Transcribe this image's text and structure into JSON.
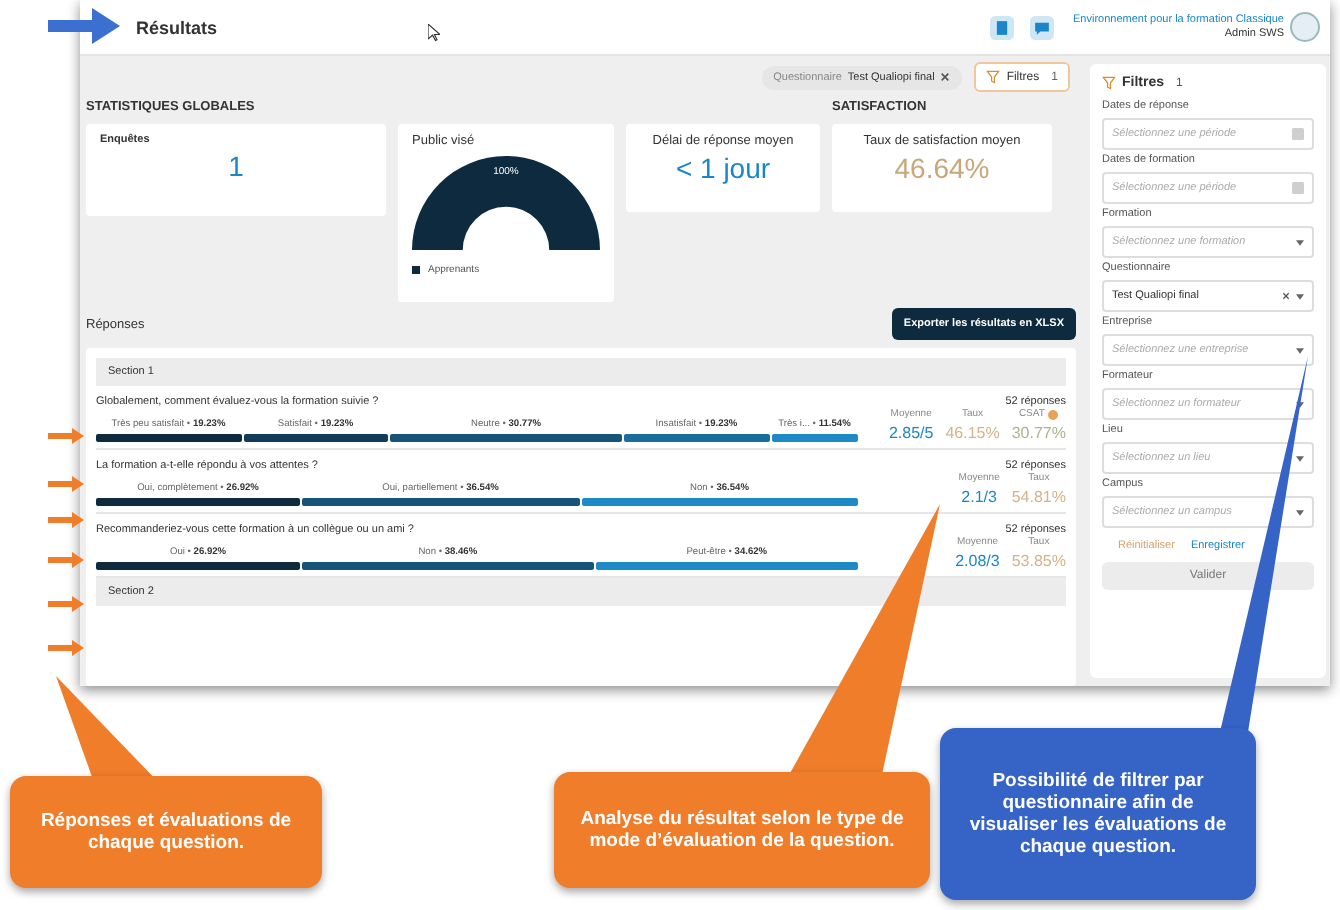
{
  "header": {
    "title": "Résultats",
    "org": "Environnement pour la formation Classique",
    "user": "Admin SWS"
  },
  "active_filter": {
    "label": "Questionnaire",
    "value": "Test Qualiopi final"
  },
  "filters_button": {
    "label": "Filtres",
    "count": "1"
  },
  "global_stats": {
    "title": "STATISTIQUES GLOBALES",
    "surveys": {
      "label": "Enquêtes",
      "value": "1"
    },
    "audience": {
      "label": "Public visé",
      "percent": "100%",
      "legend": "Apprenants"
    },
    "delay": {
      "label": "Délai de réponse moyen",
      "value": "< 1 jour"
    }
  },
  "satisfaction": {
    "title": "SATISFACTION",
    "label": "Taux de satisfaction moyen",
    "value": "46.64%"
  },
  "responses": {
    "title": "Réponses",
    "export_button": "Exporter les résultats en XLSX",
    "sections": [
      {
        "title": "Section 1",
        "questions": [
          {
            "text": "Globalement, comment évaluez-vous la formation suivie ?",
            "count": "52 réponses",
            "segments": [
              {
                "label": "Très peu satisfait •",
                "value": "19.23%",
                "color": "#0d2a3f"
              },
              {
                "label": "Satisfait •",
                "value": "19.23%",
                "color": "#123d5a"
              },
              {
                "label": "Neutre •",
                "value": "30.77%",
                "color": "#16547a"
              },
              {
                "label": "Insatisfait •",
                "value": "19.23%",
                "color": "#1b6d9c"
              },
              {
                "label": "Très i... •",
                "value": "11.54%",
                "color": "#1f8ac8"
              }
            ],
            "metrics": [
              {
                "label": "Moyenne",
                "value": "2.85/5",
                "kind": "average",
                "help": false
              },
              {
                "label": "Taux",
                "value": "46.15%",
                "kind": "rate",
                "help": false
              },
              {
                "label": "CSAT",
                "value": "30.77%",
                "kind": "csat",
                "help": true
              }
            ]
          },
          {
            "text": "La formation a-t-elle répondu à vos attentes ?",
            "count": "52 réponses",
            "segments": [
              {
                "label": "Oui, complètement •",
                "value": "26.92%",
                "color": "#0d2a3f"
              },
              {
                "label": "Oui, partiellement •",
                "value": "36.54%",
                "color": "#16547a"
              },
              {
                "label": "Non •",
                "value": "36.54%",
                "color": "#1f8ac8"
              }
            ],
            "metrics": [
              {
                "label": "Moyenne",
                "value": "2.1/3",
                "kind": "average",
                "help": false
              },
              {
                "label": "Taux",
                "value": "54.81%",
                "kind": "rate",
                "help": false
              }
            ]
          },
          {
            "text": "Recommanderiez-vous cette formation à un collègue ou un ami ?",
            "count": "52 réponses",
            "segments": [
              {
                "label": "Oui •",
                "value": "26.92%",
                "color": "#0d2a3f"
              },
              {
                "label": "Non •",
                "value": "38.46%",
                "color": "#16547a"
              },
              {
                "label": "Peut-être •",
                "value": "34.62%",
                "color": "#1f8ac8"
              }
            ],
            "metrics": [
              {
                "label": "Moyenne",
                "value": "2.08/3",
                "kind": "average",
                "help": false
              },
              {
                "label": "Taux",
                "value": "53.85%",
                "kind": "rate",
                "help": false
              }
            ]
          }
        ]
      },
      {
        "title": "Section 2"
      }
    ]
  },
  "filter_panel": {
    "title": "Filtres",
    "count": "1",
    "fields": [
      {
        "label": "Dates de réponse",
        "placeholder": "Sélectionnez une période",
        "kind": "date"
      },
      {
        "label": "Dates de formation",
        "placeholder": "Sélectionnez une période",
        "kind": "date"
      },
      {
        "label": "Formation",
        "placeholder": "Sélectionnez une formation",
        "kind": "select"
      },
      {
        "label": "Questionnaire",
        "value": "Test Qualiopi final",
        "kind": "select"
      },
      {
        "label": "Entreprise",
        "placeholder": "Sélectionnez une entreprise",
        "kind": "select"
      },
      {
        "label": "Formateur",
        "placeholder": "Sélectionnez un formateur",
        "kind": "select"
      },
      {
        "label": "Lieu",
        "placeholder": "Sélectionnez un lieu",
        "kind": "select"
      },
      {
        "label": "Campus",
        "placeholder": "Sélectionnez un campus",
        "kind": "select"
      }
    ],
    "reset_link": "Réinitialiser",
    "save_link": "Enregistrer",
    "apply_button": "Valider"
  },
  "callouts": [
    {
      "text": "Réponses et évaluations de chaque question.",
      "color": "#ef7d2a"
    },
    {
      "text": "Analyse du résultat selon le type de mode d’évaluation de la question.",
      "color": "#ef7d2a"
    },
    {
      "text": "Possibilité de filtrer par questionnaire afin de visualiser les évaluations de chaque question.",
      "color": "#3563c6"
    }
  ]
}
